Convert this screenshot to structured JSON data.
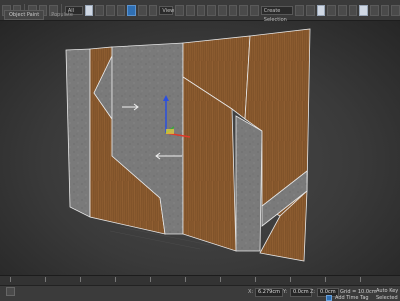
{
  "app": {
    "name": "3ds Max"
  },
  "toolbar": {
    "selection_filter": "All",
    "view_dropdown": "View",
    "create_selection_set": "Create Selection Se"
  },
  "ribbon_tabs": [
    "Object Paint",
    "Populate"
  ],
  "timeline": {
    "frame_ticks": [
      "0",
      "10",
      "20",
      "30",
      "40",
      "50",
      "60",
      "70",
      "80",
      "90",
      "100"
    ]
  },
  "status": {
    "x_label": "X:",
    "x_value": "6.279cm",
    "y_label": "Y:",
    "y_value": "0.0cm",
    "z_label": "Z:",
    "z_value": "0.0cm",
    "grid_label": "Grid = 10.0cm",
    "auto_key_label": "Auto Key",
    "selected_label": "Selected",
    "add_time_tag": "Add Time Tag"
  },
  "colors": {
    "wood": "#8a5a2e",
    "concrete": "#7d7d7d",
    "selection_outline": "#f2f2f2",
    "gizmo_x": "#e03a2a",
    "gizmo_y": "#3aa83a",
    "gizmo_z": "#2a4fe0"
  }
}
